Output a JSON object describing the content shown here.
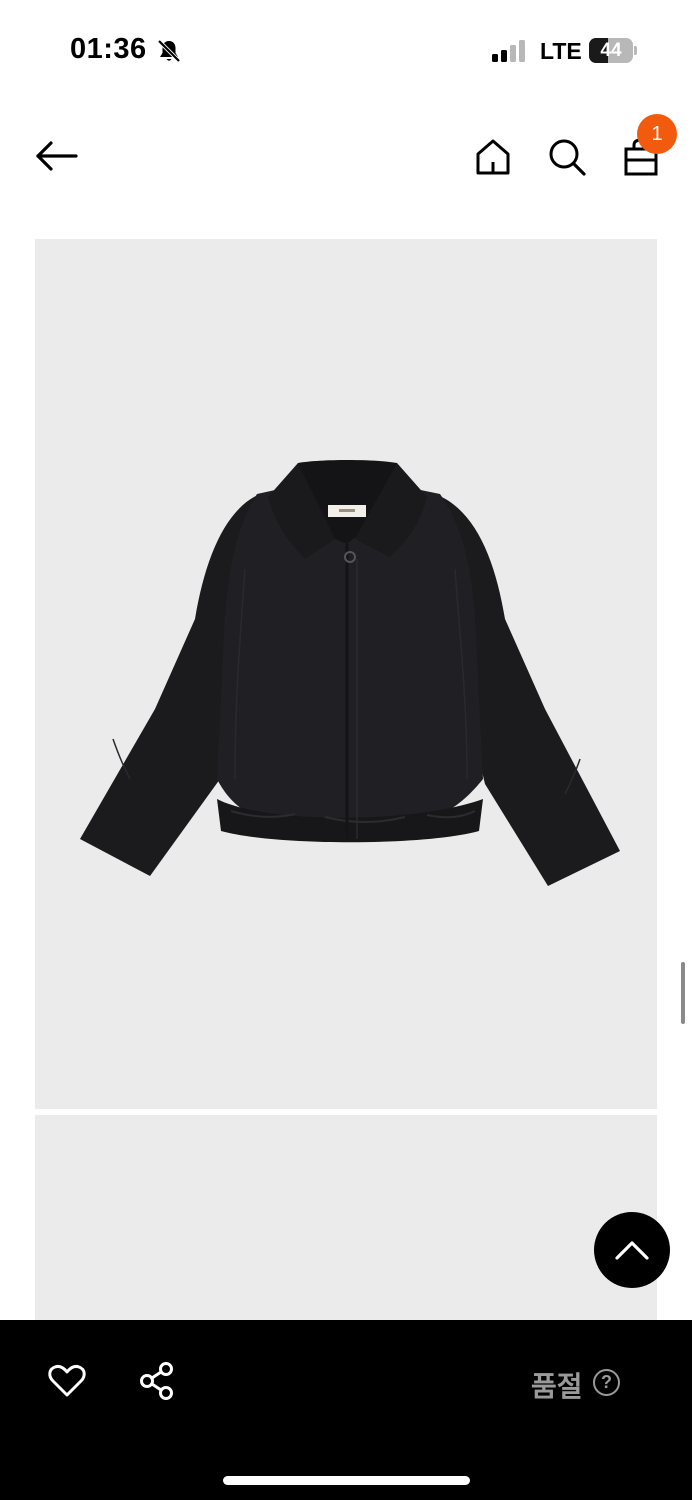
{
  "status_bar": {
    "time": "01:36",
    "network": "LTE",
    "battery_level": "44",
    "battery_fraction": 0.44,
    "icons": [
      "bell-slash-icon",
      "signal-icon",
      "battery-icon"
    ]
  },
  "header": {
    "cart_count": "1",
    "badge_color": "#f25a0e",
    "icons": [
      "back-arrow-icon",
      "home-icon",
      "search-icon",
      "shopping-bag-icon"
    ]
  },
  "product": {
    "image_subject": "black cropped puffer jacket",
    "background_color": "#ebebeb"
  },
  "bottom_bar": {
    "status_label": "품절",
    "help_symbol": "?",
    "icons": [
      "heart-icon",
      "share-icon",
      "help-icon"
    ],
    "label_color": "#9a9a9a"
  }
}
